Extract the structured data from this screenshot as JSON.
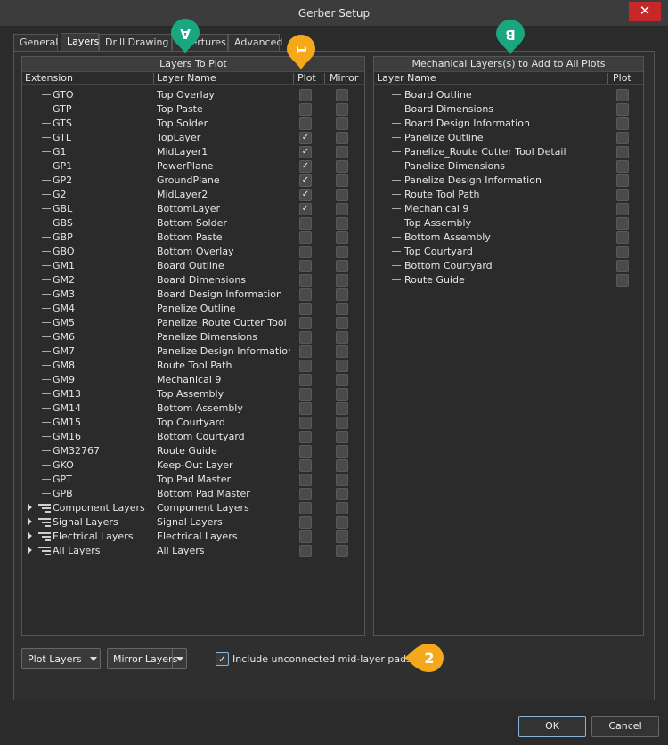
{
  "window": {
    "title": "Gerber Setup"
  },
  "tabs": [
    "General",
    "Layers",
    "Drill Drawing",
    "Apertures",
    "Advanced"
  ],
  "layers_panel": {
    "header": "Layers To Plot",
    "columns": {
      "extension": "Extension",
      "layer_name": "Layer Name",
      "plot": "Plot",
      "mirror": "Mirror"
    },
    "rows": [
      {
        "ext": "GTO",
        "name": "Top Overlay",
        "plot": false,
        "group": false
      },
      {
        "ext": "GTP",
        "name": "Top Paste",
        "plot": false,
        "group": false
      },
      {
        "ext": "GTS",
        "name": "Top Solder",
        "plot": false,
        "group": false
      },
      {
        "ext": "GTL",
        "name": "TopLayer",
        "plot": true,
        "group": false
      },
      {
        "ext": "G1",
        "name": "MidLayer1",
        "plot": true,
        "group": false
      },
      {
        "ext": "GP1",
        "name": "PowerPlane",
        "plot": true,
        "group": false
      },
      {
        "ext": "GP2",
        "name": "GroundPlane",
        "plot": true,
        "group": false
      },
      {
        "ext": "G2",
        "name": "MidLayer2",
        "plot": true,
        "group": false
      },
      {
        "ext": "GBL",
        "name": "BottomLayer",
        "plot": true,
        "group": false
      },
      {
        "ext": "GBS",
        "name": "Bottom Solder",
        "plot": false,
        "group": false
      },
      {
        "ext": "GBP",
        "name": "Bottom Paste",
        "plot": false,
        "group": false
      },
      {
        "ext": "GBO",
        "name": "Bottom Overlay",
        "plot": false,
        "group": false
      },
      {
        "ext": "GM1",
        "name": "Board Outline",
        "plot": false,
        "group": false
      },
      {
        "ext": "GM2",
        "name": "Board Dimensions",
        "plot": false,
        "group": false
      },
      {
        "ext": "GM3",
        "name": "Board Design Information",
        "plot": false,
        "group": false
      },
      {
        "ext": "GM4",
        "name": "Panelize Outline",
        "plot": false,
        "group": false
      },
      {
        "ext": "GM5",
        "name": "Panelize_Route Cutter Tool D",
        "plot": false,
        "group": false
      },
      {
        "ext": "GM6",
        "name": "Panelize Dimensions",
        "plot": false,
        "group": false
      },
      {
        "ext": "GM7",
        "name": "Panelize Design Information",
        "plot": false,
        "group": false
      },
      {
        "ext": "GM8",
        "name": "Route Tool Path",
        "plot": false,
        "group": false
      },
      {
        "ext": "GM9",
        "name": "Mechanical 9",
        "plot": false,
        "group": false
      },
      {
        "ext": "GM13",
        "name": "Top Assembly",
        "plot": false,
        "group": false
      },
      {
        "ext": "GM14",
        "name": "Bottom Assembly",
        "plot": false,
        "group": false
      },
      {
        "ext": "GM15",
        "name": "Top Courtyard",
        "plot": false,
        "group": false
      },
      {
        "ext": "GM16",
        "name": "Bottom Courtyard",
        "plot": false,
        "group": false
      },
      {
        "ext": "GM32767",
        "name": "Route Guide",
        "plot": false,
        "group": false
      },
      {
        "ext": "GKO",
        "name": "Keep-Out Layer",
        "plot": false,
        "group": false
      },
      {
        "ext": "GPT",
        "name": "Top Pad Master",
        "plot": false,
        "group": false
      },
      {
        "ext": "GPB",
        "name": "Bottom Pad Master",
        "plot": false,
        "group": false
      },
      {
        "ext": "Component Layers",
        "name": "Component Layers",
        "plot": false,
        "group": true
      },
      {
        "ext": "Signal Layers",
        "name": "Signal Layers",
        "plot": false,
        "group": true
      },
      {
        "ext": "Electrical Layers",
        "name": "Electrical Layers",
        "plot": false,
        "group": true
      },
      {
        "ext": "All Layers",
        "name": "All Layers",
        "plot": false,
        "group": true
      }
    ]
  },
  "mech_panel": {
    "header": "Mechanical Layers(s) to Add to All Plots",
    "columns": {
      "layer_name": "Layer Name",
      "plot": "Plot"
    },
    "rows": [
      "Board Outline",
      "Board Dimensions",
      "Board Design Information",
      "Panelize Outline",
      "Panelize_Route Cutter Tool Detail",
      "Panelize Dimensions",
      "Panelize Design Information",
      "Route Tool Path",
      "Mechanical 9",
      "Top Assembly",
      "Bottom Assembly",
      "Top Courtyard",
      "Bottom Courtyard",
      "Route Guide"
    ]
  },
  "controls": {
    "plot_layers_label": "Plot Layers",
    "mirror_layers_label": "Mirror Layers",
    "include_pads_label": "Include unconnected mid-layer pads",
    "include_pads_checked": true
  },
  "buttons": {
    "ok": "OK",
    "cancel": "Cancel"
  },
  "callouts": {
    "a": "A",
    "one": "1",
    "b": "B",
    "two": "2"
  },
  "colors": {
    "callout_green": "#1aa77f",
    "callout_orange": "#f5a81c",
    "close_red": "#c62828"
  }
}
